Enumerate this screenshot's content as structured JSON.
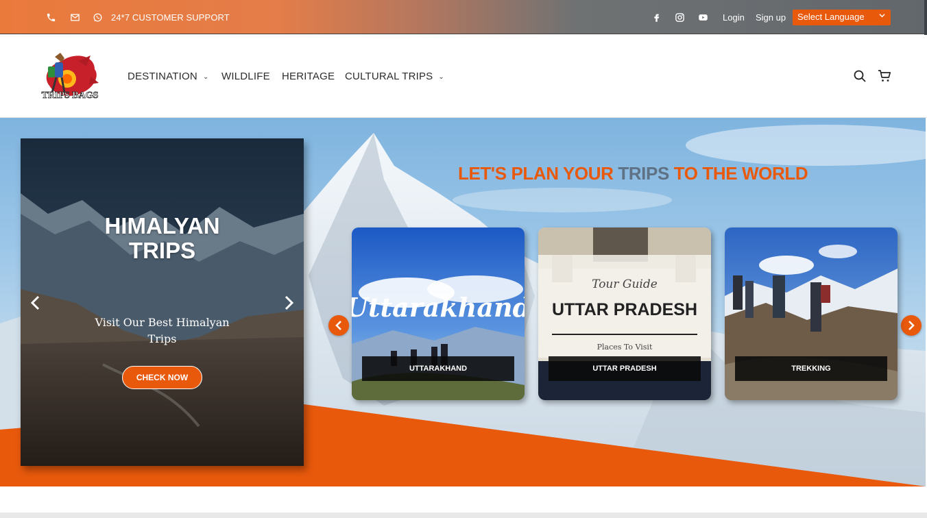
{
  "topbar": {
    "support_text": "24*7 CUSTOMER SUPPORT",
    "login": "Login",
    "signup": "Sign up",
    "language": "Select Language",
    "icons": [
      "phone-icon",
      "email-icon",
      "whatsapp-icon",
      "facebook-icon",
      "instagram-icon",
      "youtube-icon"
    ]
  },
  "header": {
    "logo_text": "TRIPS BAGS",
    "nav": [
      {
        "label": "DESTINATION",
        "has_dropdown": true
      },
      {
        "label": "WILDLIFE",
        "has_dropdown": false
      },
      {
        "label": "HERITAGE",
        "has_dropdown": false
      },
      {
        "label": "CULTURAL TRIPS",
        "has_dropdown": true
      }
    ],
    "caret": "⌄"
  },
  "hero": {
    "slide": {
      "title_line1": "HIMALYAN",
      "title_line2": "TRIPS",
      "subtitle": "Visit Our Best Himalyan Trips",
      "button": "CHECK NOW"
    },
    "heading_part1": "LET'S PLAN YOUR ",
    "heading_part2": "TRIPS",
    "heading_part3": " TO THE WORLD",
    "cards": [
      {
        "label": "UTTARAKHAND",
        "image_text": "Uttarakhand"
      },
      {
        "label": "UTTAR PRADESH",
        "image_line1": "Tour Guide",
        "image_line2": "UTTAR PRADESH",
        "image_line3": "Places To Visit"
      },
      {
        "label": "TREKKING"
      }
    ]
  },
  "colors": {
    "accent": "#e8590c",
    "heading_mid": "#5f7184",
    "topbar_gray": "#62676c"
  }
}
